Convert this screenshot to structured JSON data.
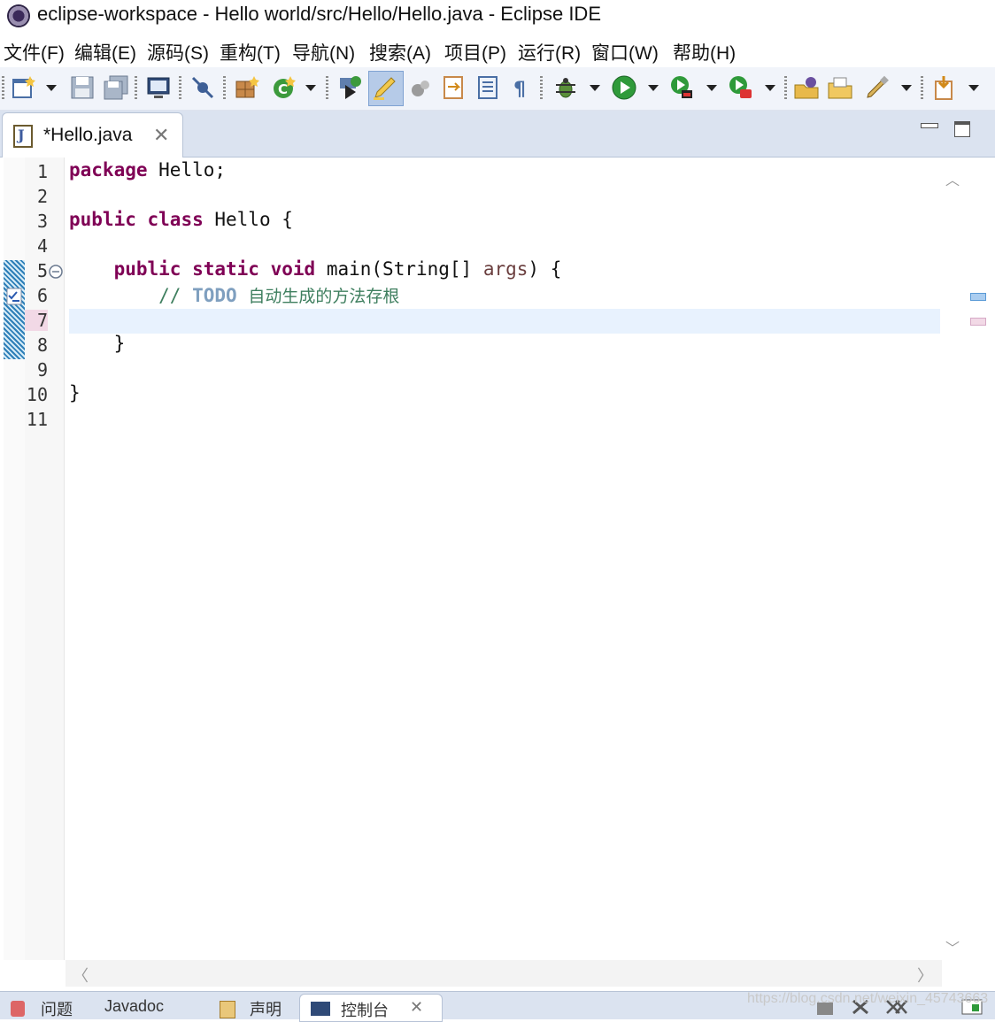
{
  "window": {
    "title": "eclipse-workspace - Hello world/src/Hello/Hello.java - Eclipse IDE"
  },
  "menu": [
    "文件(F)",
    "编辑(E)",
    "源码(S)",
    "重构(T)",
    "导航(N)",
    "搜索(A)",
    "项目(P)",
    "运行(R)",
    "窗口(W)",
    "帮助(H)"
  ],
  "toolbar": {
    "icons": [
      "new-wizard-icon",
      "save-icon",
      "save-all-icon",
      "terminal-icon",
      "skip-breakpoints-icon",
      "open-type-icon",
      "new-java-class-icon",
      "debug-launch-icon",
      "mark-occurrences-icon",
      "toggle-comment-icon",
      "next-annotation-icon",
      "block-selection-icon",
      "show-whitespace-icon",
      "debug-icon",
      "run-icon",
      "coverage-icon",
      "run-last-tool-icon",
      "open-project-icon",
      "open-folder-icon",
      "external-tools-icon",
      "next-edit-icon"
    ]
  },
  "editor": {
    "tab_label": "*Hello.java",
    "tab_icon": "java-file-icon",
    "lines": [
      {
        "num": "1"
      },
      {
        "num": "2"
      },
      {
        "num": "3"
      },
      {
        "num": "4"
      },
      {
        "num": "5"
      },
      {
        "num": "6"
      },
      {
        "num": "7"
      },
      {
        "num": "8"
      },
      {
        "num": "9"
      },
      {
        "num": "10"
      },
      {
        "num": "11"
      }
    ],
    "code": {
      "l1_kw": "package",
      "l1_rest": " Hello;",
      "l3_kw1": "public",
      "l3_kw2": "class",
      "l3_rest": " Hello {",
      "l5_indent": "    ",
      "l5_kw1": "public",
      "l5_kw2": "static",
      "l5_kw3": "void",
      "l5_mid": " main(String[] ",
      "l5_param": "args",
      "l5_end": ") {",
      "l6_slash": "        // ",
      "l6_todo": "TODO",
      "l6_cjk": "自动生成的方法存根",
      "l8": "    }",
      "l10": "}"
    },
    "current_line": "7"
  },
  "bottom_tabs": [
    "问题",
    "Javadoc",
    "声明",
    "控制台"
  ],
  "watermark": "https://blog.csdn.net/weixin_45743663"
}
